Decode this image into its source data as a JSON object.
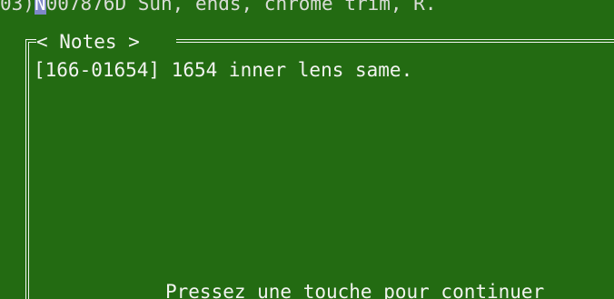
{
  "terminal": {
    "header_prefix": "03)",
    "header_cursor": "N",
    "header_rest": "007876D Sun, ends, chrome trim, R.",
    "notes_title": "< Notes >",
    "note_line": "[166-01654] 1654 inner lens same.",
    "prompt": "Pressez une touche pour continuer"
  },
  "colors": {
    "background": "#236b12",
    "text": "#f2f4f0",
    "cursor": "#7f88c8"
  }
}
